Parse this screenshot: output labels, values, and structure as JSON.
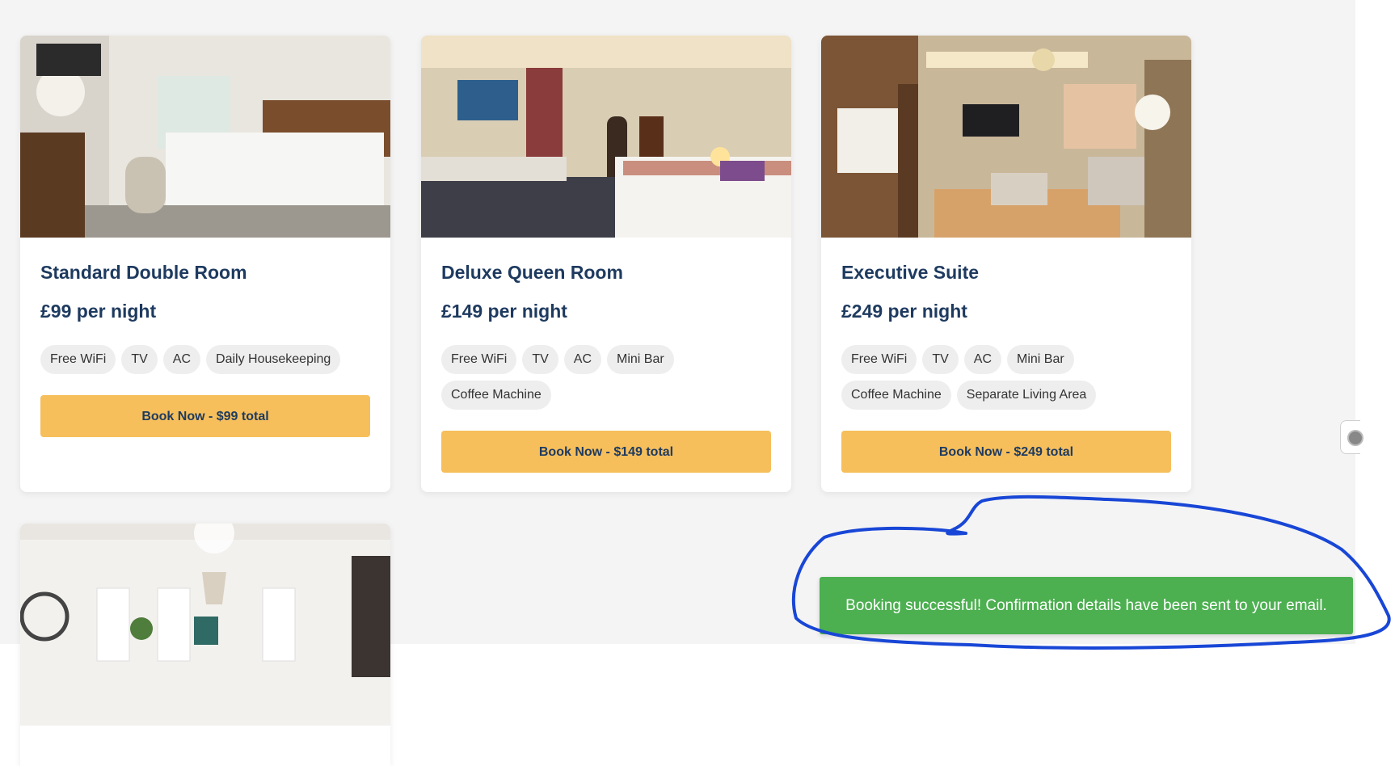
{
  "rooms": [
    {
      "title": "Standard Double Room",
      "price": "£99 per night",
      "amenities": [
        "Free WiFi",
        "TV",
        "AC",
        "Daily Housekeeping"
      ],
      "button": "Book Now - $99 total"
    },
    {
      "title": "Deluxe Queen Room",
      "price": "£149 per night",
      "amenities": [
        "Free WiFi",
        "TV",
        "AC",
        "Mini Bar",
        "Coffee Machine"
      ],
      "button": "Book Now - $149 total"
    },
    {
      "title": "Executive Suite",
      "price": "£249 per night",
      "amenities": [
        "Free WiFi",
        "TV",
        "AC",
        "Mini Bar",
        "Coffee Machine",
        "Separate Living Area"
      ],
      "button": "Book Now - $249 total"
    }
  ],
  "toast": {
    "message": "Booking successful! Confirmation details have been sent to your email."
  },
  "colors": {
    "accent": "#f6bf5c",
    "heading": "#1e3a5f",
    "success": "#4caf50",
    "annotation": "#1846d6"
  }
}
